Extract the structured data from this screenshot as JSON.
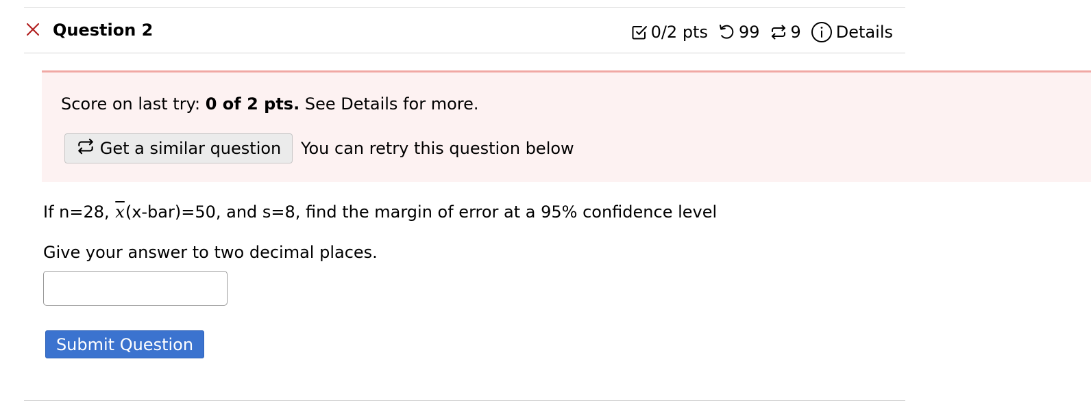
{
  "question": {
    "status_icon": "close-icon",
    "title": "Question 2",
    "points": "0/2 pts",
    "attempts_remaining": "99",
    "similar_remaining": "9",
    "details_label": "Details",
    "icons": {
      "points": "checkbox-icon",
      "attempts": "undo-icon",
      "similar": "retry-arrows-icon",
      "details": "info-circle-icon"
    }
  },
  "alert": {
    "score_prefix": "Score on last try: ",
    "score_value": "0 of 2 pts.",
    "score_suffix": " See Details for more.",
    "similar_button_label": "Get a similar question",
    "retry_text": "You can retry this question below"
  },
  "body": {
    "prompt_prefix": "If n=28, ",
    "xbar_symbol": "x",
    "prompt_suffix": "(x-bar)=50, and s=8, find the margin of error at a 95% confidence level",
    "instruction": "Give your answer to two decimal places.",
    "answer_value": "",
    "answer_placeholder": "",
    "submit_label": "Submit Question"
  },
  "colors": {
    "incorrect_icon": "#b22222",
    "alert_background": "#fdf2f2",
    "alert_border": "#f0a8a4",
    "submit_background": "#3b73cf",
    "similar_button_background": "#ebebeb"
  }
}
